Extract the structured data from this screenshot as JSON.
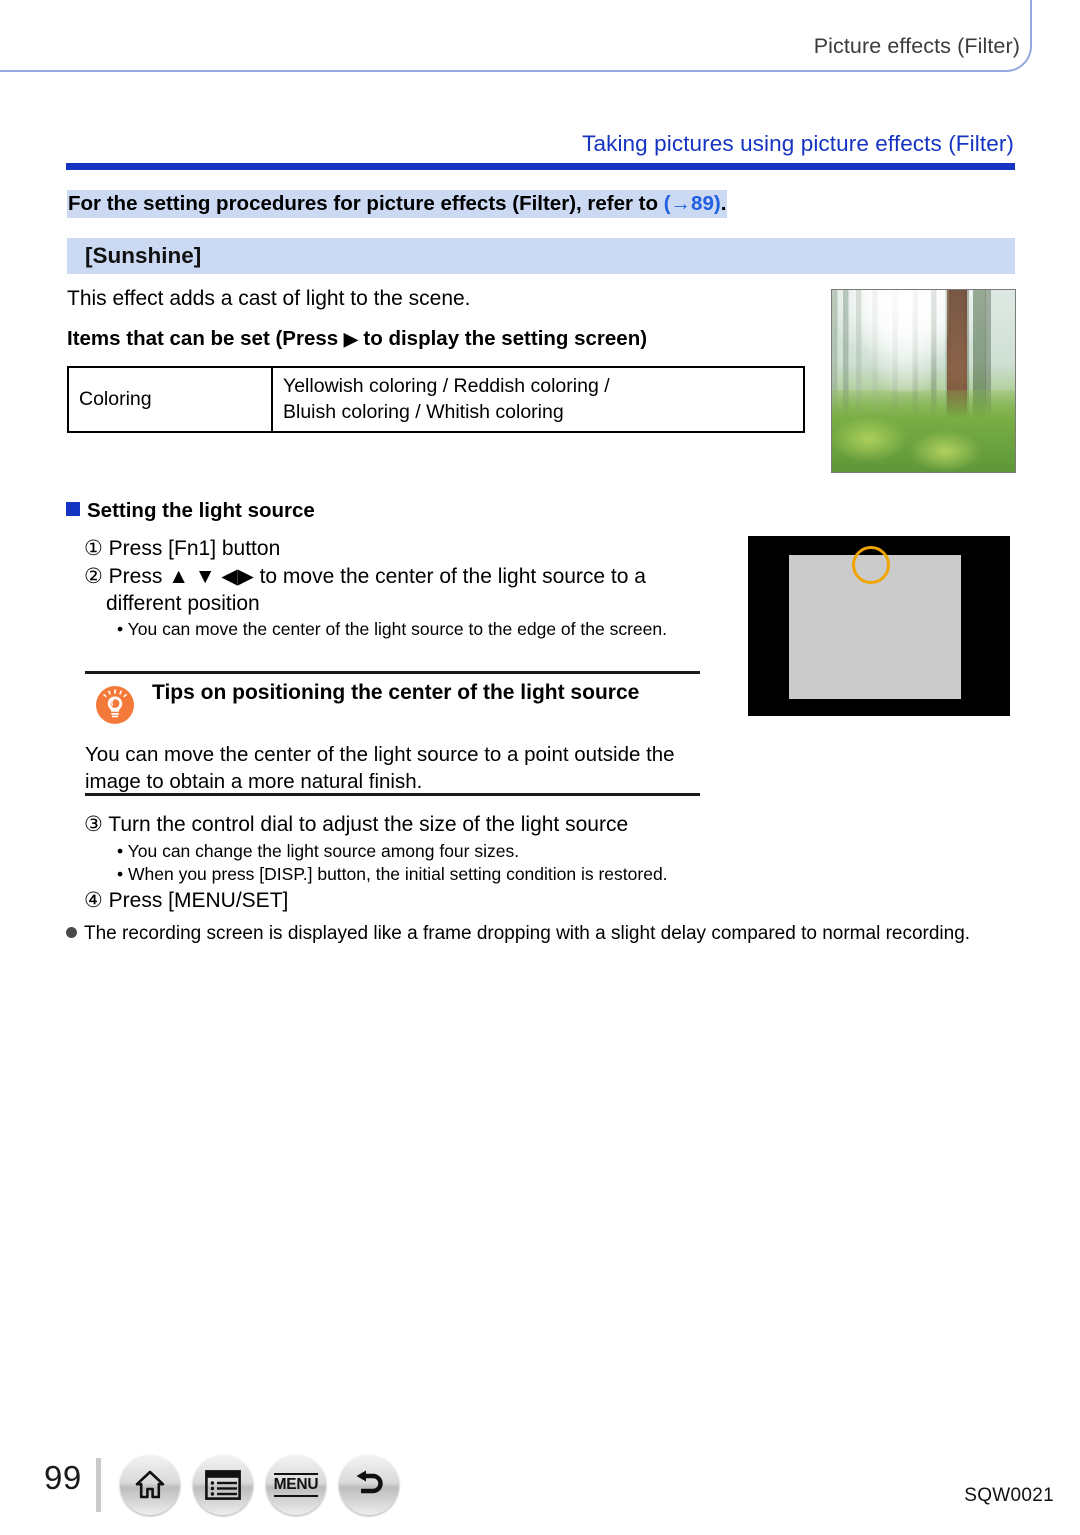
{
  "header": {
    "running_head": "Picture effects (Filter)",
    "frame_color": "#96a8de"
  },
  "section": {
    "title": "Taking pictures using picture effects  (Filter)",
    "accent_color": "#1534c2"
  },
  "reference": {
    "text_before": "For the setting procedures for picture effects (Filter), refer to ",
    "link": "(→89)",
    "text_after": ".",
    "highlight_color": "#ccd9f2"
  },
  "effect": {
    "name": "[Sunshine]",
    "description": "This effect adds a cast of light to the scene.",
    "items_heading_before": "Items that can be set (Press ",
    "items_heading_arrow": "▶",
    "items_heading_after": " to display the setting screen)"
  },
  "settings_table": {
    "rows": [
      {
        "item": "Coloring",
        "values_line1": "Yellowish coloring / Reddish coloring /",
        "values_line2": "Bluish coloring / Whitish coloring"
      }
    ]
  },
  "light_source": {
    "heading": "Setting the light source",
    "steps": {
      "step1": "① Press [Fn1] button",
      "step2_prefix": "② Press ",
      "step2_arrows": "▲ ▼ ◀▶",
      "step2_suffix": " to move the center of the light source to a",
      "step2_cont": "different position",
      "step2_bullet": "• You can move the center of the light source to the edge of the screen.",
      "step3": "③ Turn the control dial to adjust the size of the light source",
      "step3_bullet1": "• You can change the light source among four sizes.",
      "step3_bullet2": "• When you press [DISP.] button, the initial setting condition is restored.",
      "step4": "④ Press [MENU/SET]"
    }
  },
  "tip": {
    "icon": "lightbulb-icon",
    "icon_color": "#f47a3c",
    "title": "Tips on positioning the center of the light source",
    "body": "You can move the center of the light source to a point outside the image to obtain a more natural finish."
  },
  "camera_illustration": {
    "screen_color": "#cbcbcb",
    "bezel_color": "#000000",
    "light_marker_color": "#f0a400"
  },
  "note": {
    "text": "The recording screen is displayed like a frame dropping with a slight delay compared to normal recording."
  },
  "footer": {
    "page_number": "99",
    "nav_items": [
      {
        "name": "home-icon",
        "label": ""
      },
      {
        "name": "contents-icon",
        "label": ""
      },
      {
        "name": "menu-icon",
        "label": "MENU"
      },
      {
        "name": "back-icon",
        "label": ""
      }
    ],
    "doc_code": "SQW0021"
  }
}
